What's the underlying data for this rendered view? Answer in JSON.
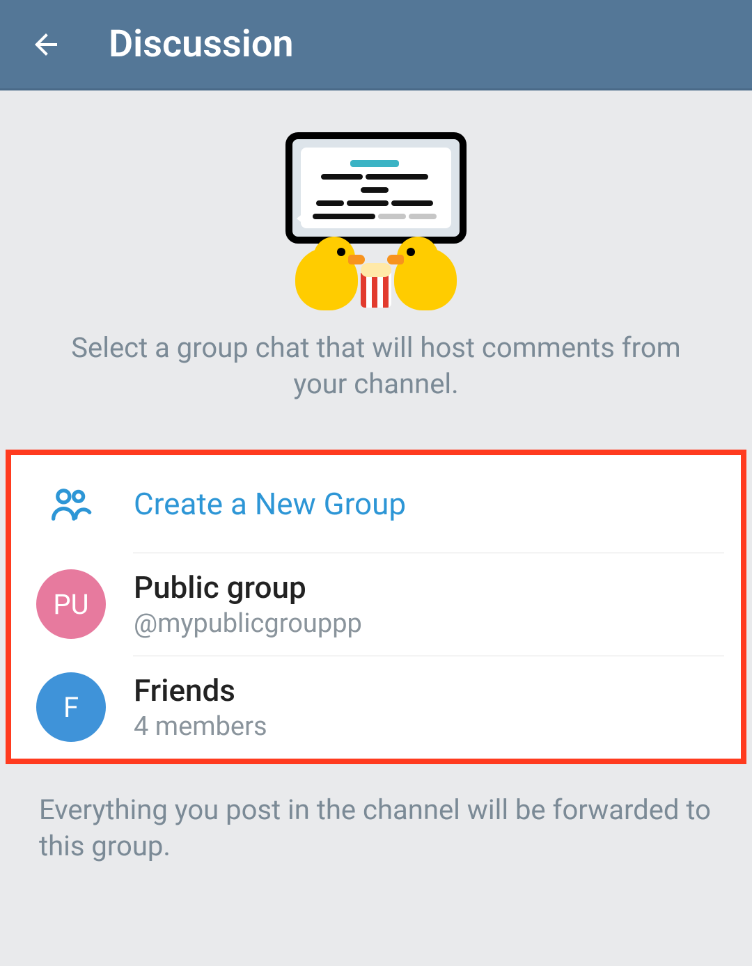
{
  "header": {
    "title": "Discussion"
  },
  "hero": {
    "description": "Select a group chat that will host comments from your channel."
  },
  "list": {
    "create_label": "Create a New Group",
    "groups": [
      {
        "name": "Public group",
        "subtitle": "@mypublicgrouppp",
        "avatar_initials": "PU",
        "avatar_color": "#e77a9e"
      },
      {
        "name": "Friends",
        "subtitle": "4 members",
        "avatar_initials": "F",
        "avatar_color": "#3f93d9"
      }
    ]
  },
  "footer": {
    "note": "Everything you post in the channel will be forwarded to this group."
  },
  "colors": {
    "accent": "#2d96d6",
    "highlight_border": "#ff3b1f"
  }
}
